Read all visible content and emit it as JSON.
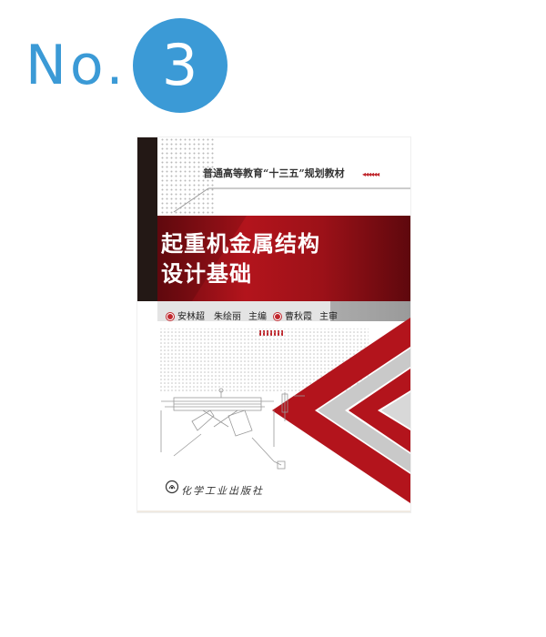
{
  "rank": {
    "prefix": "No.",
    "number": "3",
    "color": "#3b9ad6"
  },
  "book": {
    "series": "普通高等教育“十三五”规划教材",
    "series_arrows": "◂◂◂◂◂◂",
    "title_line1": "起重机金属结构",
    "title_line2": "设计基础",
    "authors": {
      "editors": "安林超　朱绘丽",
      "editors_role": "主编",
      "reviewer": "曹秋霞",
      "reviewer_role": "主审"
    },
    "publisher": "化学工业出版社",
    "colors": {
      "title_band": "#8b0f17",
      "dark_bar": "#231815",
      "chevron_red": "#b3141c",
      "chevron_gray": "#8e8e8e"
    }
  }
}
